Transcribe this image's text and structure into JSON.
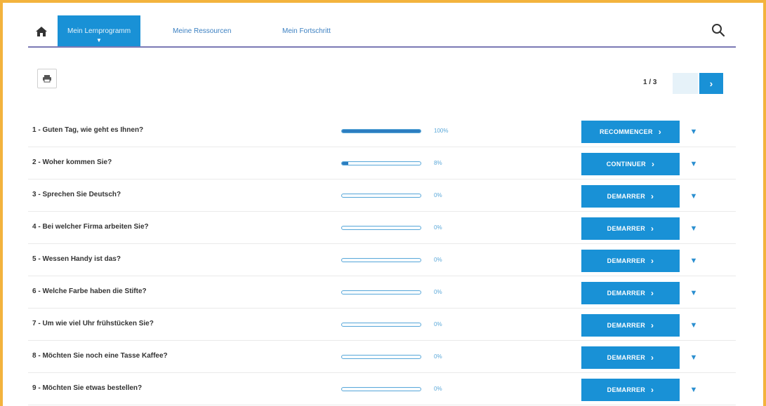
{
  "nav": {
    "tabs": [
      {
        "label": "Mein Lernprogramm",
        "active": true
      },
      {
        "label": "Meine Ressourcen",
        "active": false
      },
      {
        "label": "Mein Fortschritt",
        "active": false
      }
    ]
  },
  "pager": {
    "text": "1 / 3",
    "next_label": "›"
  },
  "colors": {
    "accent": "#1991d6",
    "frame": "#f3b33d",
    "nav_underline": "#7b79b4"
  },
  "lessons": [
    {
      "title": "1 - Guten Tag, wie geht es Ihnen?",
      "progress": 100,
      "pct": "100%",
      "action": "RECOMMENCER"
    },
    {
      "title": "2 - Woher kommen Sie?",
      "progress": 8,
      "pct": "8%",
      "action": "CONTINUER"
    },
    {
      "title": "3 - Sprechen Sie Deutsch?",
      "progress": 0,
      "pct": "0%",
      "action": "DEMARRER"
    },
    {
      "title": "4 - Bei welcher Firma arbeiten Sie?",
      "progress": 0,
      "pct": "0%",
      "action": "DEMARRER"
    },
    {
      "title": "5 - Wessen Handy ist das?",
      "progress": 0,
      "pct": "0%",
      "action": "DEMARRER"
    },
    {
      "title": "6 - Welche Farbe haben die Stifte?",
      "progress": 0,
      "pct": "0%",
      "action": "DEMARRER"
    },
    {
      "title": "7 - Um wie viel Uhr frühstücken Sie?",
      "progress": 0,
      "pct": "0%",
      "action": "DEMARRER"
    },
    {
      "title": "8 - Möchten Sie noch eine Tasse Kaffee?",
      "progress": 0,
      "pct": "0%",
      "action": "DEMARRER"
    },
    {
      "title": "9 - Möchten Sie etwas bestellen?",
      "progress": 0,
      "pct": "0%",
      "action": "DEMARRER"
    }
  ]
}
